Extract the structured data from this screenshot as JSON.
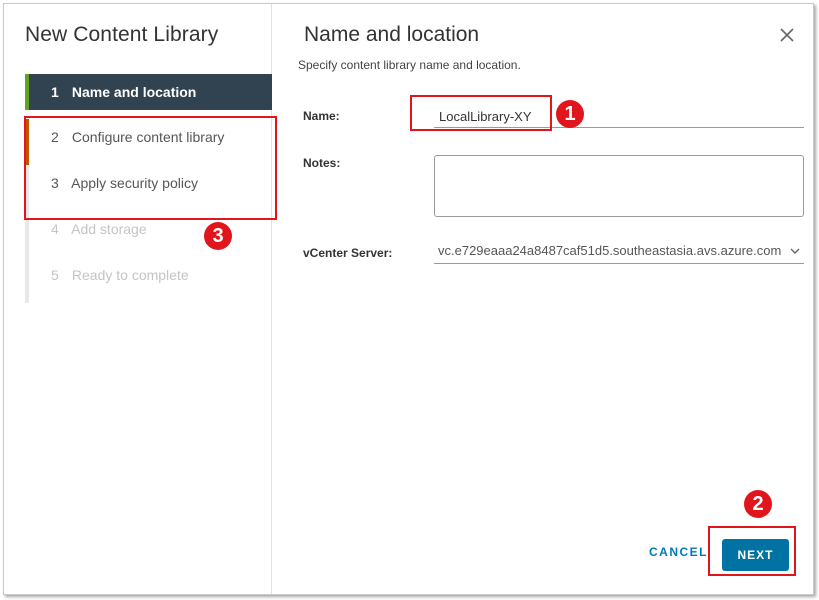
{
  "wizard": {
    "title": "New Content Library",
    "steps": [
      {
        "num": "1",
        "label": "Name and location"
      },
      {
        "num": "2",
        "label": "Configure content library"
      },
      {
        "num": "3",
        "label": "Apply security policy"
      },
      {
        "num": "4",
        "label": "Add storage"
      },
      {
        "num": "5",
        "label": "Ready to complete"
      }
    ]
  },
  "page": {
    "title": "Name and location",
    "subtitle": "Specify content library name and location."
  },
  "form": {
    "name_label": "Name:",
    "name_value": "LocalLibrary-XY",
    "notes_label": "Notes:",
    "notes_value": "",
    "vcenter_label": "vCenter Server:",
    "vcenter_value": "vc.e729eaaa24a8487caf51d5.southeastasia.avs.azure.com"
  },
  "footer": {
    "cancel_label": "CANCEL",
    "next_label": "NEXT"
  },
  "annotations": {
    "badge1": "1",
    "badge2": "2",
    "badge3": "3"
  },
  "colors": {
    "active_step_bg": "#314351",
    "active_step_accent": "#62a420",
    "primary_button": "#0072a3",
    "link": "#0079b8",
    "annotation_red": "#e0161c"
  }
}
